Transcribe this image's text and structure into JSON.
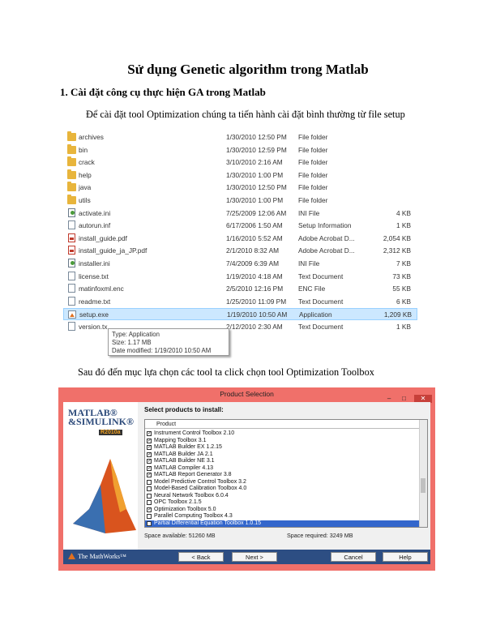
{
  "title": "Sử dụng Genetic algorithm trong Matlab",
  "section1": "1. Cài đặt công cụ thực hiện GA trong Matlab",
  "para1": "Để cài đặt tool Optimization chúng ta tiến hành cài đặt bình thường từ file setup",
  "para2": "Sau đó đến mục lựa chọn các tool ta click chọn tool Optimization Toolbox",
  "files": [
    {
      "icon": "folder",
      "name": "archives",
      "date": "1/30/2010 12:50 PM",
      "type": "File folder",
      "size": ""
    },
    {
      "icon": "folder",
      "name": "bin",
      "date": "1/30/2010 12:59 PM",
      "type": "File folder",
      "size": ""
    },
    {
      "icon": "folder",
      "name": "crack",
      "date": "3/10/2010 2:16 AM",
      "type": "File folder",
      "size": ""
    },
    {
      "icon": "folder",
      "name": "help",
      "date": "1/30/2010 1:00 PM",
      "type": "File folder",
      "size": ""
    },
    {
      "icon": "folder",
      "name": "java",
      "date": "1/30/2010 12:50 PM",
      "type": "File folder",
      "size": ""
    },
    {
      "icon": "folder",
      "name": "utils",
      "date": "1/30/2010 1:00 PM",
      "type": "File folder",
      "size": ""
    },
    {
      "icon": "ini",
      "name": "activate.ini",
      "date": "7/25/2009 12:06 AM",
      "type": "INI File",
      "size": "4 KB"
    },
    {
      "icon": "file",
      "name": "autorun.inf",
      "date": "6/17/2006 1:50 AM",
      "type": "Setup Information",
      "size": "1 KB"
    },
    {
      "icon": "pdf",
      "name": "install_guide.pdf",
      "date": "1/16/2010 5:52 AM",
      "type": "Adobe Acrobat D...",
      "size": "2,054 KB"
    },
    {
      "icon": "pdf",
      "name": "install_guide_ja_JP.pdf",
      "date": "2/1/2010 8:32 AM",
      "type": "Adobe Acrobat D...",
      "size": "2,312 KB"
    },
    {
      "icon": "ini",
      "name": "installer.ini",
      "date": "7/4/2009 6:39 AM",
      "type": "INI File",
      "size": "7 KB"
    },
    {
      "icon": "file",
      "name": "license.txt",
      "date": "1/19/2010 4:18 AM",
      "type": "Text Document",
      "size": "73 KB"
    },
    {
      "icon": "file",
      "name": "matinfoxml.enc",
      "date": "2/5/2010 12:16 PM",
      "type": "ENC File",
      "size": "55 KB"
    },
    {
      "icon": "file",
      "name": "readme.txt",
      "date": "1/25/2010 11:09 PM",
      "type": "Text Document",
      "size": "6 KB"
    },
    {
      "icon": "exe",
      "name": "setup.exe",
      "date": "1/19/2010 10:50 AM",
      "type": "Application",
      "size": "1,209 KB"
    },
    {
      "icon": "file",
      "name": "version.tx",
      "date": "2/12/2010 2:30 AM",
      "type": "Text Document",
      "size": "1 KB"
    }
  ],
  "tooltip": {
    "line1": "Type: Application",
    "line2": "Size: 1.17 MB",
    "line3": "Date modified: 1/19/2010 10:50 AM"
  },
  "installer": {
    "title": "Product Selection",
    "logo_line1": "MATLAB®",
    "logo_line2": "&SIMULINK®",
    "logo_version": "R2010a",
    "select_label": "Select products to install:",
    "column_header": "Product",
    "products": [
      {
        "label": "Instrument Control Toolbox 2.10",
        "checked": true
      },
      {
        "label": "Mapping Toolbox 3.1",
        "checked": true
      },
      {
        "label": "MATLAB Builder EX 1.2.15",
        "checked": true
      },
      {
        "label": "MATLAB Builder JA 2.1",
        "checked": true
      },
      {
        "label": "MATLAB Builder NE 3.1",
        "checked": true
      },
      {
        "label": "MATLAB Compiler 4.13",
        "checked": true
      },
      {
        "label": "MATLAB Report Generator 3.8",
        "checked": true
      },
      {
        "label": "Model Predictive Control Toolbox 3.2",
        "checked": false
      },
      {
        "label": "Model-Based Calibration Toolbox 4.0",
        "checked": false
      },
      {
        "label": "Neural Network Toolbox 6.0.4",
        "checked": false
      },
      {
        "label": "OPC Toolbox 2.1.5",
        "checked": false
      },
      {
        "label": "Optimization Toolbox 5.0",
        "checked": true
      },
      {
        "label": "Parallel Computing Toolbox 4.3",
        "checked": false
      },
      {
        "label": "Partial Differential Equation Toolbox 1.0.15",
        "checked": false
      }
    ],
    "space_available": "Space available: 51260 MB",
    "space_required": "Space required: 3249 MB",
    "company": "The MathWorks™",
    "back_button": "< Back",
    "next_button": "Next >",
    "cancel_button": "Cancel",
    "help_button": "Help",
    "minimize": "–",
    "maximize": "□",
    "close": "✕"
  }
}
